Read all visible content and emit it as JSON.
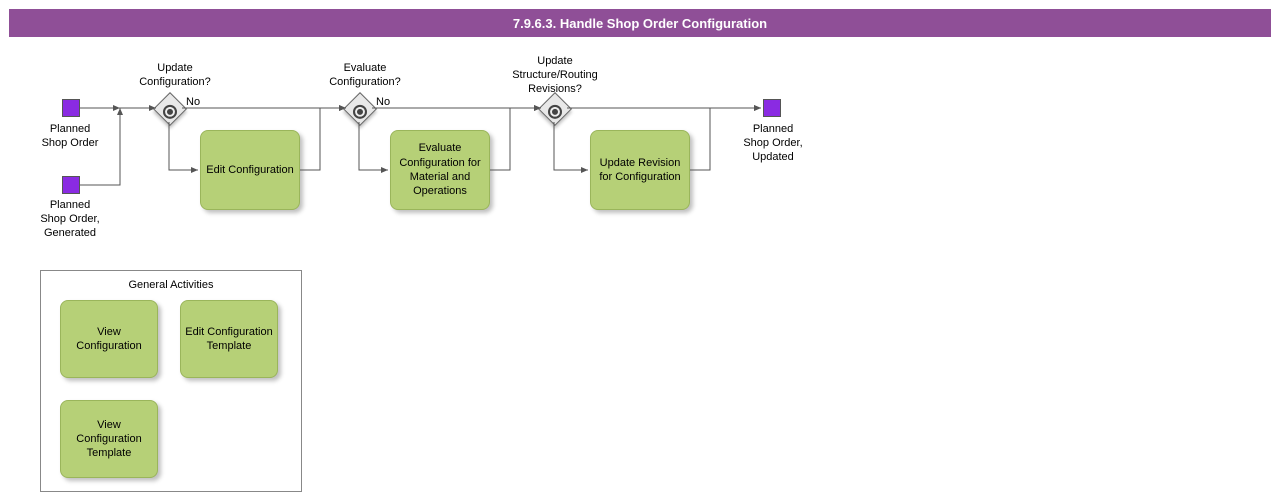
{
  "title": "7.9.6.3. Handle Shop Order Configuration",
  "events": {
    "start1": "Planned\nShop Order",
    "start2": "Planned\nShop Order,\nGenerated",
    "end": "Planned\nShop Order,\nUpdated"
  },
  "gateways": {
    "g1": {
      "label": "Update\nConfiguration?",
      "no": "No"
    },
    "g2": {
      "label": "Evaluate\nConfiguration?",
      "no": "No"
    },
    "g3": {
      "label": "Update\nStructure/Routing\nRevisions?",
      "no": ""
    }
  },
  "tasks": {
    "t1": "Edit\nConfiguration",
    "t2": "Evaluate\nConfiguration for\nMaterial and\nOperations",
    "t3": "Update Revision\nfor\nConfiguration"
  },
  "group": {
    "title": "General Activities",
    "a1": "View\nConfiguration",
    "a2": "Edit\nConfiguration\nTemplate",
    "a3": "View\nConfiguration\nTemplate"
  }
}
